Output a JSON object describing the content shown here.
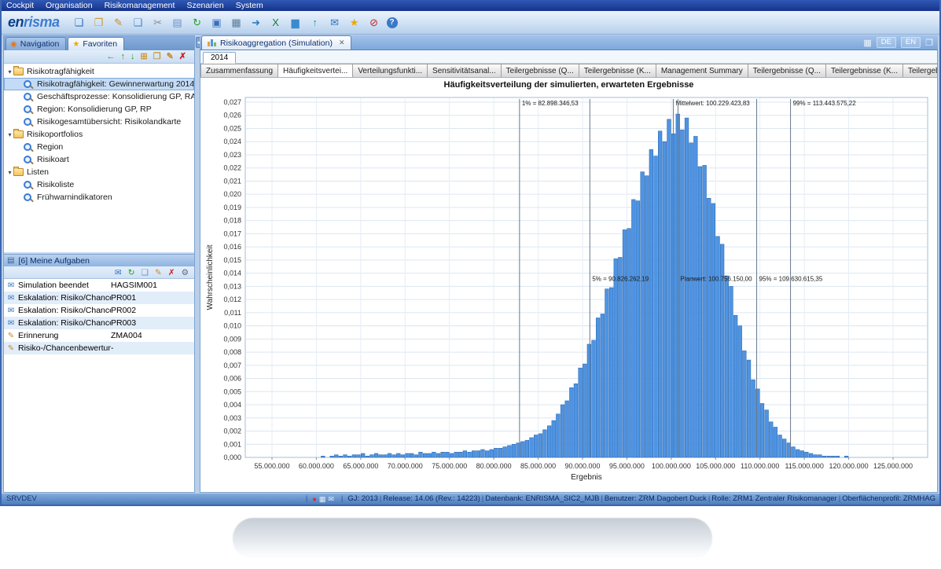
{
  "menubar": {
    "items": [
      {
        "label": "Cockpit"
      },
      {
        "label": "Organisation"
      },
      {
        "label": "Risikomanagement"
      },
      {
        "label": "Szenarien"
      },
      {
        "label": "System"
      }
    ]
  },
  "toolbar": {
    "logo_en": "en",
    "logo_risma": "risma",
    "icons": [
      {
        "name": "new-document-icon",
        "glyph": "❏",
        "color": "#2f6fbd"
      },
      {
        "name": "open-folder-icon",
        "glyph": "❐",
        "color": "#c99a3a"
      },
      {
        "name": "edit-icon",
        "glyph": "✎",
        "color": "#c98a2e"
      },
      {
        "name": "copy-icon",
        "glyph": "❑",
        "color": "#4a86c8"
      },
      {
        "name": "cut-icon",
        "glyph": "✂",
        "color": "#8a8a8a"
      },
      {
        "name": "paste-icon",
        "glyph": "▤",
        "color": "#6a93c8"
      },
      {
        "name": "refresh-icon",
        "glyph": "↻",
        "color": "#22a022"
      },
      {
        "name": "save-icon",
        "glyph": "▣",
        "color": "#3a6fbd"
      },
      {
        "name": "print-icon",
        "glyph": "▦",
        "color": "#5a7a9a"
      },
      {
        "name": "export-icon",
        "glyph": "➜",
        "color": "#2e7dc2"
      },
      {
        "name": "excel-export-icon",
        "glyph": "X",
        "color": "#1e7d34"
      },
      {
        "name": "chart-icon",
        "glyph": "▆",
        "color": "#3a8ad0"
      },
      {
        "name": "upload-icon",
        "glyph": "↑",
        "color": "#2a9aa0"
      },
      {
        "name": "mail-icon",
        "glyph": "✉",
        "color": "#2f6fbd"
      },
      {
        "name": "favorite-star-icon",
        "glyph": "★",
        "color": "#f0a800"
      },
      {
        "name": "stop-icon",
        "glyph": "⊘",
        "color": "#cc2020"
      },
      {
        "name": "help-icon",
        "glyph": "?",
        "color": "#ffffff",
        "bg": "#3a78c8"
      }
    ]
  },
  "left_panel": {
    "expander_glyph": "▾",
    "tabs": [
      {
        "label": "Navigation",
        "icon_name": "navigation-icon",
        "glyph": "◉",
        "color": "#e07820",
        "active": false
      },
      {
        "label": "Favoriten",
        "icon_name": "favorites-star-icon",
        "glyph": "★",
        "color": "#f0a800",
        "active": true
      }
    ],
    "tree_toolbar": [
      {
        "name": "move-left-icon",
        "glyph": "←",
        "color": "#22a022"
      },
      {
        "name": "move-up-icon",
        "glyph": "↑",
        "color": "#22a022"
      },
      {
        "name": "move-down-icon",
        "glyph": "↓",
        "color": "#22a022"
      },
      {
        "name": "add-favorite-icon",
        "glyph": "⊞",
        "color": "#c99a3a"
      },
      {
        "name": "add-folder-icon",
        "glyph": "❐",
        "color": "#c99a3a"
      },
      {
        "name": "edit-favorite-icon",
        "glyph": "✎",
        "color": "#c98a2e"
      },
      {
        "name": "delete-favorite-icon",
        "glyph": "✗",
        "color": "#cc2020"
      }
    ],
    "tree_rows": [
      {
        "depth": 0,
        "folder": true,
        "label": "Risikotragfähigkeit"
      },
      {
        "depth": 1,
        "folder": false,
        "label": "Risikotragfähigkeit: Gewinnerwartung 2014",
        "selected": true
      },
      {
        "depth": 1,
        "folder": false,
        "label": "Geschäftsprozesse: Konsolidierung GP, RA"
      },
      {
        "depth": 1,
        "folder": false,
        "label": "Region: Konsolidierung GP, RP"
      },
      {
        "depth": 1,
        "folder": false,
        "label": "Risikogesamtübersicht: Risikolandkarte"
      },
      {
        "depth": 0,
        "folder": true,
        "label": "Risikoportfolios"
      },
      {
        "depth": 1,
        "folder": false,
        "label": "Region"
      },
      {
        "depth": 1,
        "folder": false,
        "label": "Risikoart"
      },
      {
        "depth": 0,
        "folder": true,
        "label": "Listen"
      },
      {
        "depth": 1,
        "folder": false,
        "label": "Risikoliste"
      },
      {
        "depth": 1,
        "folder": false,
        "label": "Frühwarnindikatoren"
      }
    ],
    "tasks": {
      "header": "[6] Meine Aufgaben",
      "toolbar": [
        {
          "name": "task-mail-icon",
          "glyph": "✉",
          "color": "#2f6fbd"
        },
        {
          "name": "task-refresh-icon",
          "glyph": "↻",
          "color": "#22a022"
        },
        {
          "name": "task-open-icon",
          "glyph": "❏",
          "color": "#6a8ec6"
        },
        {
          "name": "task-edit-icon",
          "glyph": "✎",
          "color": "#c98a2e"
        },
        {
          "name": "task-delete-icon",
          "glyph": "✗",
          "color": "#cc2020"
        },
        {
          "name": "task-settings-icon",
          "glyph": "⚙",
          "color": "#5a6a7a"
        }
      ],
      "rows": [
        {
          "icon": "mail",
          "glyph": "✉",
          "color": "#2f6fbd",
          "label": "Simulation beendet",
          "code": "HAGSIM001"
        },
        {
          "icon": "mail",
          "glyph": "✉",
          "color": "#2f6fbd",
          "label": "Eskalation: Risiko/Chance",
          "code": "PR001"
        },
        {
          "icon": "mail",
          "glyph": "✉",
          "color": "#2f6fbd",
          "label": "Eskalation: Risiko/Chance",
          "code": "PR002"
        },
        {
          "icon": "mail",
          "glyph": "✉",
          "color": "#2f6fbd",
          "label": "Eskalation: Risiko/Chance",
          "code": "PR003"
        },
        {
          "icon": "reminder",
          "glyph": "✎",
          "color": "#c98a2e",
          "label": "Erinnerung",
          "code": "ZMA004"
        },
        {
          "icon": "reminder",
          "glyph": "✎",
          "color": "#c98a2e",
          "label": "Risiko-/Chancenbewertung",
          "code": "-"
        }
      ]
    }
  },
  "main": {
    "collapse_glyph": "◀",
    "doc_tab": {
      "label": "Risikoaggregation (Simulation)",
      "close": "✕"
    },
    "right_icons": [
      {
        "name": "layout-icon",
        "glyph": "▦"
      },
      {
        "name": "detach-window-icon",
        "glyph": "❐"
      }
    ],
    "lang": {
      "de": "DE",
      "en": "EN"
    },
    "year_tab": "2014",
    "sub_tabs": [
      {
        "label": "Zusammenfassung"
      },
      {
        "label": "Häufigkeitsvertei...",
        "active": true
      },
      {
        "label": "Verteilungsfunkti..."
      },
      {
        "label": "Sensitivitätsanal..."
      },
      {
        "label": "Teilergebnisse (Q..."
      },
      {
        "label": "Teilergebnisse (K..."
      },
      {
        "label": "Management Summary"
      },
      {
        "label": "Teilergebnisse (Q..."
      },
      {
        "label": "Teilergebnisse (K..."
      },
      {
        "label": "Teilergebnisse (Q..."
      }
    ]
  },
  "statusbar": {
    "server": "SRVDEV",
    "icons": [
      {
        "name": "status-error-icon",
        "glyph": "●",
        "color": "#d03030"
      },
      {
        "name": "status-save-icon",
        "glyph": "▦",
        "color": "#e8eef6"
      },
      {
        "name": "status-mail-icon",
        "glyph": "✉",
        "color": "#e8eef6"
      }
    ],
    "segments": [
      "GJ: 2013",
      "Release: 14.06 (Rev.: 14223)",
      "Datenbank: ENRISMA_SIC2_MJB",
      "Benutzer: ZRM  Dagobert Duck",
      "Rolle: ZRM1 Zentraler Risikomanager",
      "Oberflächenprofil: ZRMHAG"
    ]
  },
  "chart_data": {
    "type": "bar",
    "title": "Häufigkeitsverteilung der simulierten, erwarteten Ergebnisse",
    "xlabel": "Ergebnis",
    "ylabel": "Wahrscheinlichkeit",
    "ylim": [
      0,
      0.027
    ],
    "y_tick_step": 0.001,
    "grid": true,
    "legend": false,
    "x_ticks": [
      55000000,
      60000000,
      65000000,
      70000000,
      75000000,
      80000000,
      85000000,
      90000000,
      95000000,
      100000000,
      105000000,
      110000000,
      115000000,
      120000000,
      125000000
    ],
    "bin_start": 55000000,
    "bin_width": 500000,
    "frequencies": [
      0,
      0,
      0,
      0,
      0,
      0,
      0,
      0,
      0,
      0,
      0,
      0.0001,
      0,
      0.0001,
      0.0002,
      0.0001,
      0.0002,
      0.0001,
      0.0002,
      0.0002,
      0.0003,
      0.0001,
      0.0002,
      0.0003,
      0.0002,
      0.0002,
      0.0003,
      0.0002,
      0.0003,
      0.0002,
      0.0003,
      0.0003,
      0.0002,
      0.0004,
      0.0003,
      0.0003,
      0.0004,
      0.0003,
      0.0004,
      0.0004,
      0.0003,
      0.0004,
      0.0004,
      0.0005,
      0.0004,
      0.0005,
      0.0005,
      0.0006,
      0.0005,
      0.0006,
      0.0007,
      0.0007,
      0.0008,
      0.0009,
      0.001,
      0.0011,
      0.0012,
      0.0013,
      0.0015,
      0.0017,
      0.0018,
      0.0021,
      0.0024,
      0.0028,
      0.0033,
      0.004,
      0.0043,
      0.0053,
      0.0056,
      0.0068,
      0.0071,
      0.0086,
      0.0089,
      0.0106,
      0.0109,
      0.0128,
      0.0129,
      0.0151,
      0.0152,
      0.0173,
      0.0174,
      0.0196,
      0.0195,
      0.0217,
      0.0214,
      0.0234,
      0.0229,
      0.0248,
      0.024,
      0.0257,
      0.0246,
      0.0261,
      0.0249,
      0.0258,
      0.0239,
      0.0244,
      0.0221,
      0.0222,
      0.0197,
      0.0193,
      0.0168,
      0.0162,
      0.0138,
      0.013,
      0.0108,
      0.01,
      0.0081,
      0.0074,
      0.0059,
      0.0052,
      0.0041,
      0.0036,
      0.0027,
      0.0023,
      0.0017,
      0.0014,
      0.0011,
      0.0008,
      0.0006,
      0.0005,
      0.0004,
      0.0003,
      0.0002,
      0.0002,
      0.0001,
      0.0001,
      0.0001,
      0.0001,
      0,
      0.0001,
      0,
      0,
      0,
      0,
      0,
      0,
      0,
      0,
      0,
      0
    ],
    "markers": [
      {
        "label": "1% = 82.898.346,53",
        "value": 82898346.53,
        "pos": "top"
      },
      {
        "label": "5% = 90.826.262,19",
        "value": 90826262.19,
        "pos": "mid"
      },
      {
        "label": "Mittelwert: 100.229.423,83",
        "value": 100229423.83,
        "pos": "top"
      },
      {
        "label": "Planwert: 100.756.150,00",
        "value": 100756150.0,
        "pos": "mid"
      },
      {
        "label": "95% = 109.630.615,35",
        "value": 109630615.35,
        "pos": "mid"
      },
      {
        "label": "99% = 113.443.575,22",
        "value": 113443575.22,
        "pos": "top"
      }
    ]
  }
}
